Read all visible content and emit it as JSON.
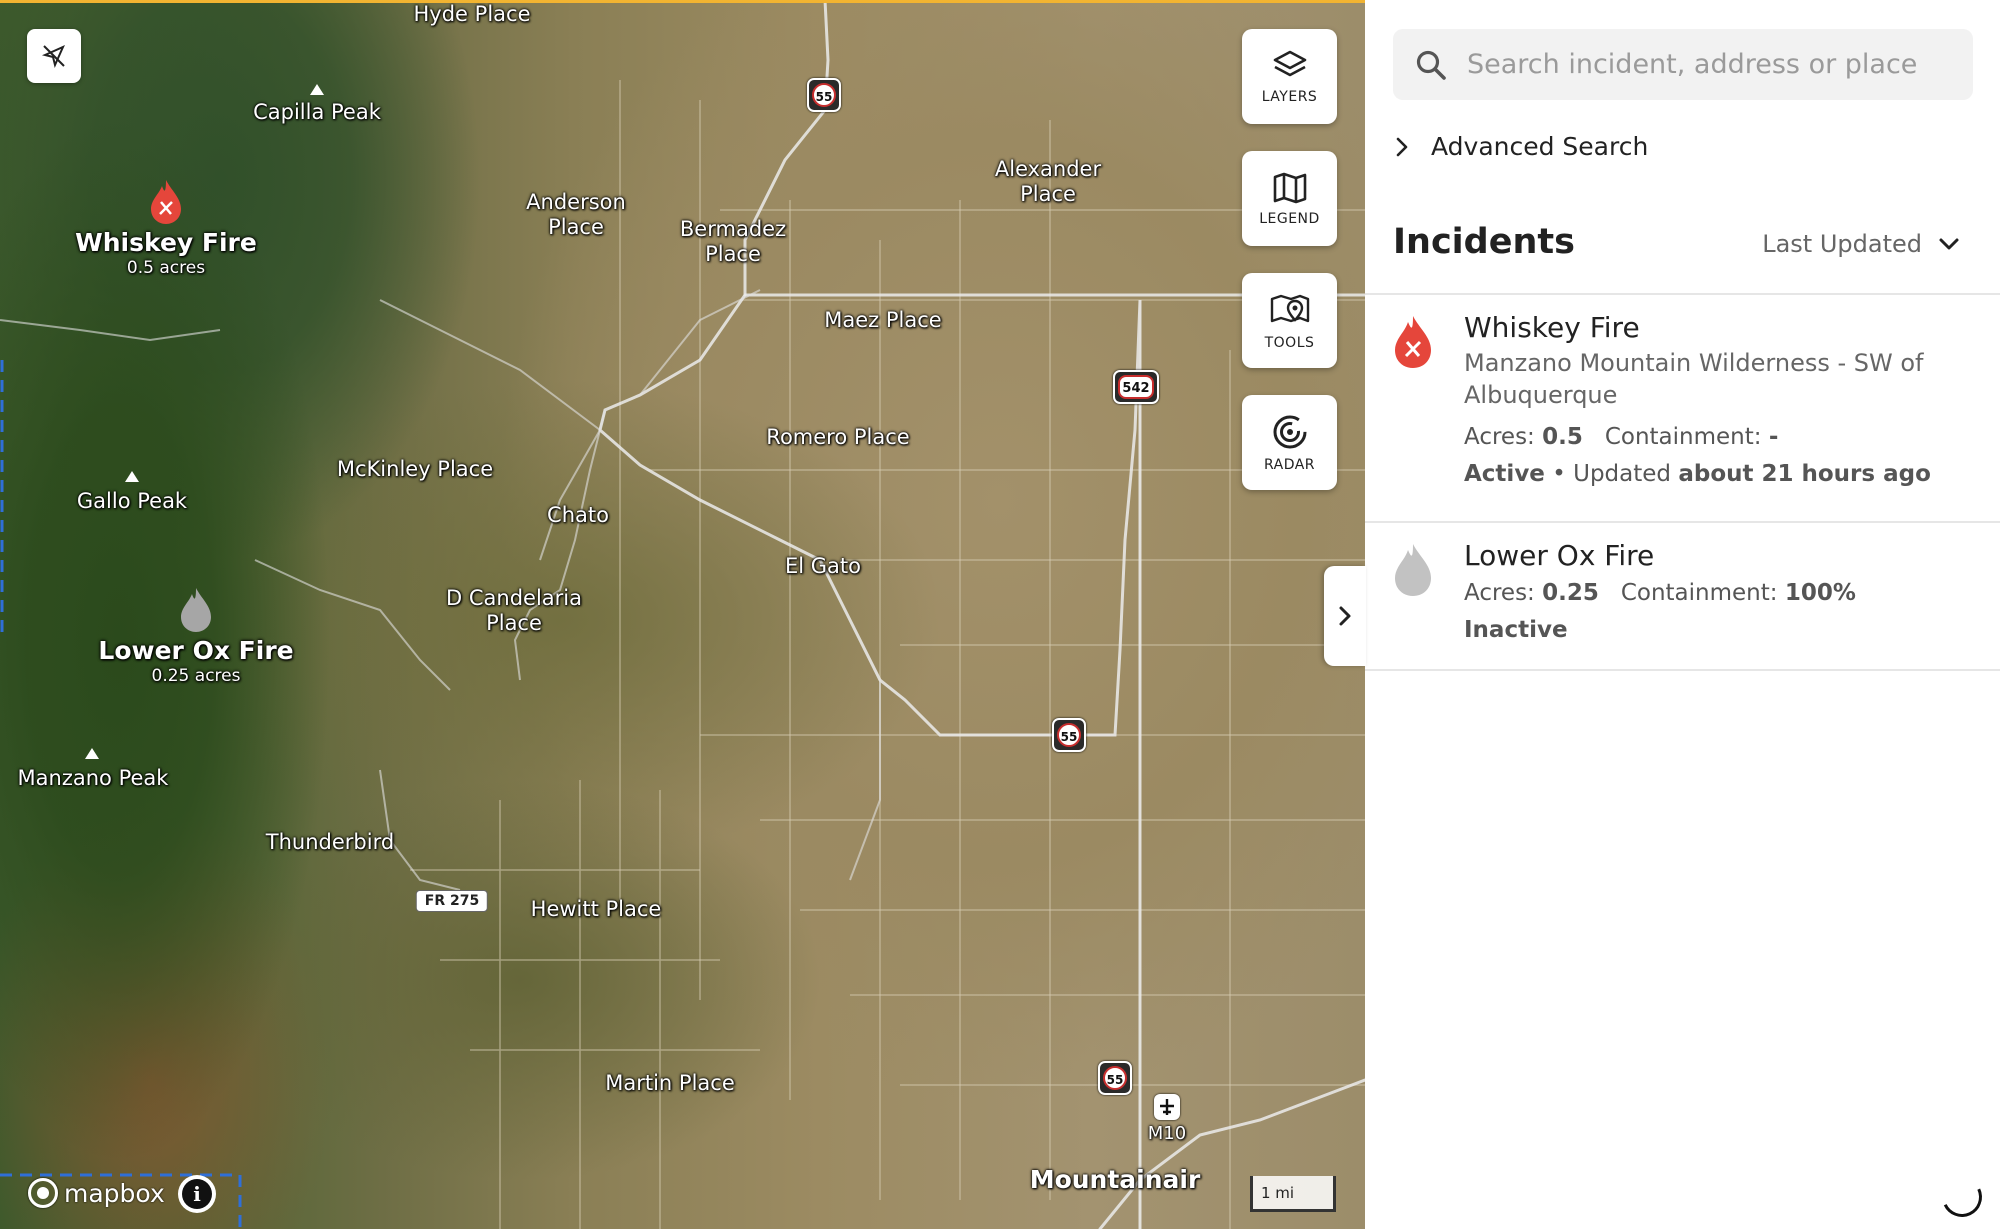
{
  "map": {
    "places": [
      {
        "id": "hyde-place",
        "lines": [
          "Hyde Place"
        ]
      },
      {
        "id": "capilla-peak",
        "lines": [
          "Capilla Peak"
        ]
      },
      {
        "id": "anderson-place",
        "lines": [
          "Anderson",
          "Place"
        ]
      },
      {
        "id": "bermadez-place",
        "lines": [
          "Bermadez",
          "Place"
        ]
      },
      {
        "id": "alexander-place",
        "lines": [
          "Alexander",
          "Place"
        ]
      },
      {
        "id": "maez-place",
        "lines": [
          "Maez Place"
        ]
      },
      {
        "id": "romero-place",
        "lines": [
          "Romero Place"
        ]
      },
      {
        "id": "mckinley-place",
        "lines": [
          "McKinley Place"
        ]
      },
      {
        "id": "gallo-peak",
        "lines": [
          "Gallo Peak"
        ]
      },
      {
        "id": "chato",
        "lines": [
          "Chato"
        ]
      },
      {
        "id": "el-gato",
        "lines": [
          "El Gato"
        ]
      },
      {
        "id": "d-candelaria-place",
        "lines": [
          "D Candelaria",
          "Place"
        ]
      },
      {
        "id": "manzano-peak",
        "lines": [
          "Manzano Peak"
        ]
      },
      {
        "id": "thunderbird",
        "lines": [
          "Thunderbird"
        ]
      },
      {
        "id": "hewitt-place",
        "lines": [
          "Hewitt Place"
        ]
      },
      {
        "id": "martin-place",
        "lines": [
          "Martin Place"
        ]
      },
      {
        "id": "m10",
        "lines": [
          "M10"
        ]
      },
      {
        "id": "mountainair",
        "lines": [
          "Mountainair"
        ]
      }
    ],
    "fires": [
      {
        "name": "Whiskey Fire",
        "acres": "0.5 acres",
        "status": "active"
      },
      {
        "name": "Lower Ox Fire",
        "acres": "0.25 acres",
        "status": "inactive"
      }
    ],
    "route_shields": [
      "55",
      "542",
      "55",
      "55"
    ],
    "forest_road": "FR 275",
    "scale": "1 mi",
    "attribution": "mapbox",
    "info_glyph": "i",
    "controls": [
      {
        "id": "layers",
        "label": "LAYERS",
        "icon": "layers-icon"
      },
      {
        "id": "legend",
        "label": "LEGEND",
        "icon": "map-icon"
      },
      {
        "id": "tools",
        "label": "TOOLS",
        "icon": "map-pin-icon"
      },
      {
        "id": "radar",
        "label": "RADAR",
        "icon": "radar-icon"
      }
    ],
    "colors": {
      "active_fire": "#e5463b",
      "inactive_fire": "#c2c2c2",
      "top_accent": "#f2b431"
    }
  },
  "sidebar": {
    "search_placeholder": "Search incident, address or place",
    "advanced_search": "Advanced Search",
    "incidents_title": "Incidents",
    "sort_label": "Last Updated",
    "incidents": [
      {
        "title": "Whiskey Fire",
        "location": "Manzano Mountain Wilderness - SW of Albuquerque",
        "acres_label": "Acres:",
        "acres": "0.5",
        "containment_label": "Containment:",
        "containment": "-",
        "status": "Active",
        "separator": "•",
        "updated_label": "Updated",
        "updated": "about 21 hours ago"
      },
      {
        "title": "Lower Ox Fire",
        "acres_label": "Acres:",
        "acres": "0.25",
        "containment_label": "Containment:",
        "containment": "100%",
        "status": "Inactive"
      }
    ]
  }
}
